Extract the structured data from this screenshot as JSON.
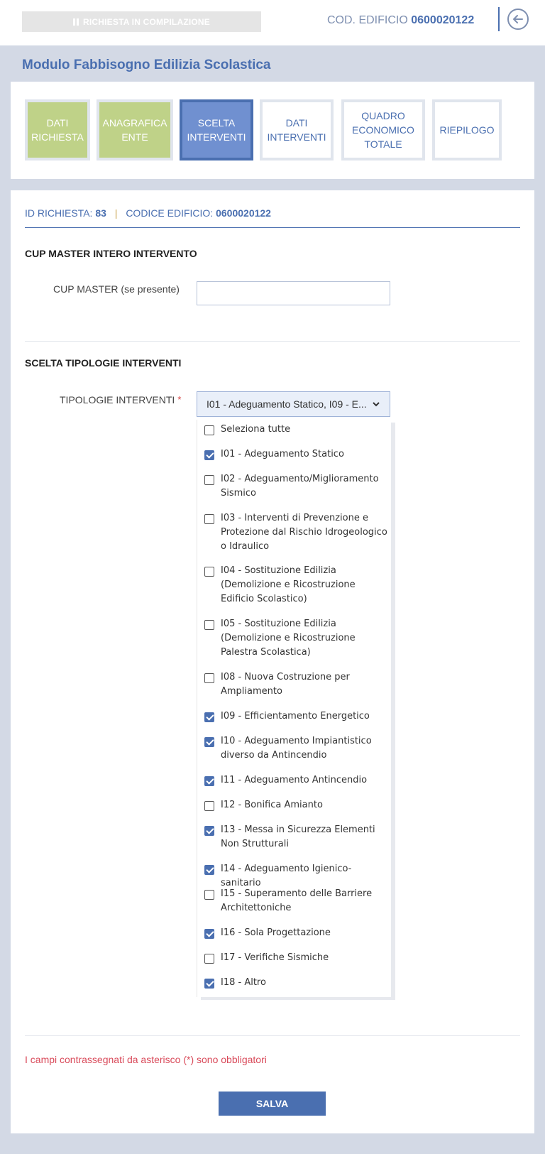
{
  "topbar": {
    "status": "RICHIESTA IN COMPILAZIONE",
    "cod_label": "COD. EDIFICIO",
    "cod_value": "0600020122"
  },
  "module_title": "Modulo Fabbisogno Edilizia Scolastica",
  "steps": [
    {
      "line1": "DATI",
      "line2": "RICHIESTA",
      "line3": "",
      "state": "done"
    },
    {
      "line1": "ANAGRAFICA",
      "line2": "ENTE",
      "line3": "",
      "state": "done"
    },
    {
      "line1": "SCELTA",
      "line2": "INTERVENTI",
      "line3": "",
      "state": "active"
    },
    {
      "line1": "DATI",
      "line2": "INTERVENTI",
      "line3": "",
      "state": "todo"
    },
    {
      "line1": "QUADRO",
      "line2": "ECONOMICO",
      "line3": "TOTALE",
      "state": "todo"
    },
    {
      "line1": "RIEPILOGO",
      "line2": "",
      "line3": "",
      "state": "todo"
    }
  ],
  "request_info": {
    "id_label": "ID RICHIESTA:",
    "id_value": "83",
    "separator": "|",
    "code_label": "CODICE EDIFICIO:",
    "code_value": "0600020122"
  },
  "cup_section": {
    "heading": "CUP MASTER INTERO INTERVENTO",
    "label": "CUP MASTER (se presente)",
    "value": ""
  },
  "tipologie_section": {
    "heading": "SCELTA TIPOLOGIE INTERVENTI",
    "label": "TIPOLOGIE INTERVENTI",
    "required_mark": "*",
    "selected_summary": "I01 - Adeguamento Statico, I09 - E...",
    "options": [
      {
        "label": "Seleziona tutte",
        "checked": false
      },
      {
        "label": "I01 - Adeguamento Statico",
        "checked": true
      },
      {
        "label": "I02 - Adeguamento/Miglioramento Sismico",
        "checked": false
      },
      {
        "label": "I03 - Interventi di Prevenzione e Protezione dal Rischio Idrogeologico o Idraulico",
        "checked": false
      },
      {
        "label": "I04 - Sostituzione Edilizia (Demolizione e Ricostruzione Edificio Scolastico)",
        "checked": false
      },
      {
        "label": "I05 - Sostituzione Edilizia (Demolizione e Ricostruzione Palestra Scolastica)",
        "checked": false
      },
      {
        "label": "I08 - Nuova Costruzione per Ampliamento",
        "checked": false
      },
      {
        "label": "I09 - Efficientamento Energetico",
        "checked": true
      },
      {
        "label": "I10 - Adeguamento Impiantistico diverso da Antincendio",
        "checked": true
      },
      {
        "label": "I11 - Adeguamento Antincendio",
        "checked": true
      },
      {
        "label": "I12 - Bonifica Amianto",
        "checked": false
      },
      {
        "label": "I13 - Messa in Sicurezza Elementi Non Strutturali",
        "checked": true
      },
      {
        "label": "I14 - Adeguamento Igienico-sanitario",
        "checked": true
      },
      {
        "label": "I15 - Superamento delle Barriere Architettoniche",
        "checked": false
      },
      {
        "label": "I16 - Sola Progettazione",
        "checked": true
      },
      {
        "label": "I17 - Verifiche Sismiche",
        "checked": false
      },
      {
        "label": "I18 - Altro",
        "checked": true
      }
    ]
  },
  "footnote": "I campi contrassegnati da asterisco (*) sono obbligatori",
  "save_label": "SALVA",
  "colors": {
    "accent": "#4a6fb0",
    "step_done": "#bfd288",
    "step_active": "#7090d0",
    "required": "#d94a5a"
  }
}
